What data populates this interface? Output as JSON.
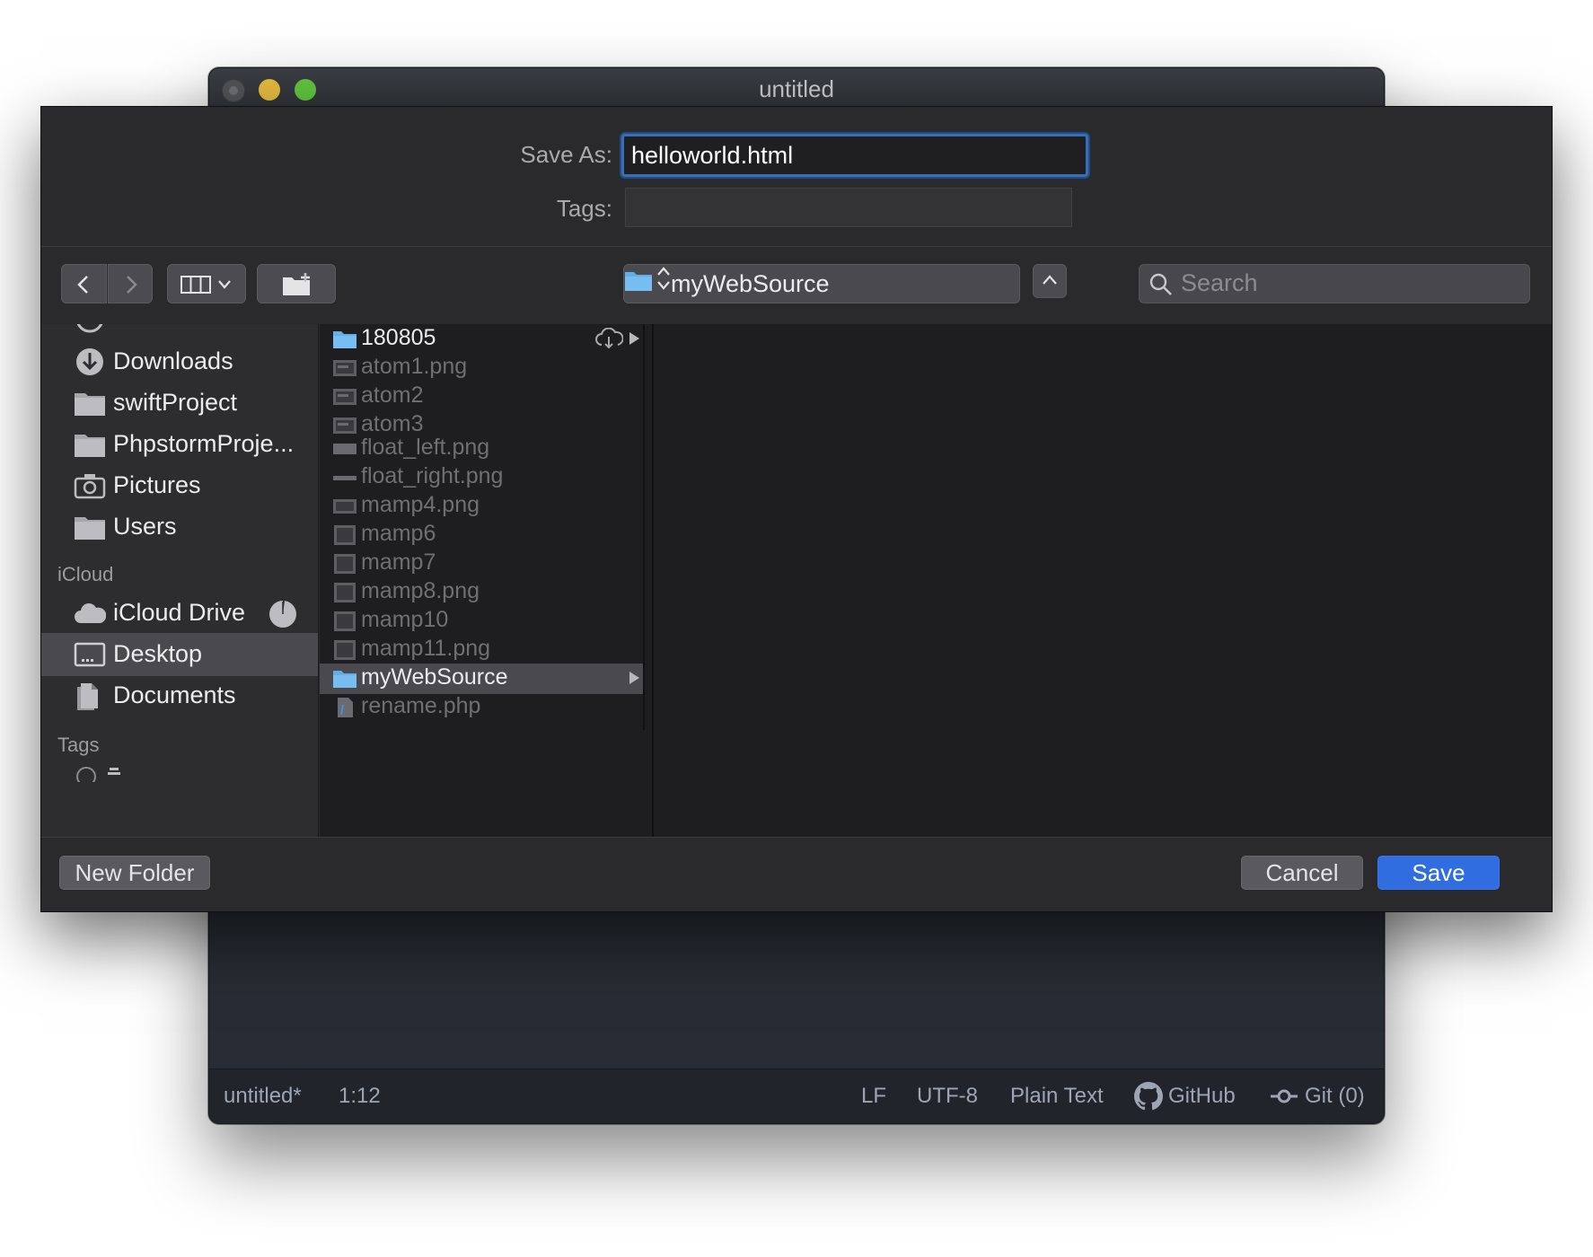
{
  "editor": {
    "title": "untitled",
    "status": {
      "filename": "untitled*",
      "cursor": "1:12",
      "line_ending": "LF",
      "encoding": "UTF-8",
      "grammar": "Plain Text",
      "github": "GitHub",
      "git": "Git (0)"
    }
  },
  "dialog": {
    "save_as_label": "Save As:",
    "save_as_value": "helloworld.html",
    "tags_label": "Tags:",
    "location": "myWebSource",
    "search_placeholder": "Search",
    "sidebar": {
      "favorites": [
        {
          "label": "Downloads",
          "icon": "downloads-icon"
        },
        {
          "label": "swiftProject",
          "icon": "folder-icon"
        },
        {
          "label": "PhpstormProje...",
          "icon": "folder-icon"
        },
        {
          "label": "Pictures",
          "icon": "camera-icon"
        },
        {
          "label": "Users",
          "icon": "folder-icon"
        }
      ],
      "icloud_header": "iCloud",
      "icloud": [
        {
          "label": "iCloud Drive",
          "icon": "cloud-icon"
        },
        {
          "label": "Desktop",
          "icon": "desktop-icon",
          "selected": true
        },
        {
          "label": "Documents",
          "icon": "documents-icon"
        }
      ],
      "tags_header": "Tags"
    },
    "files": [
      {
        "name": "180805",
        "type": "folder",
        "enabled": true,
        "cloud": true
      },
      {
        "name": "atom1.png",
        "type": "image",
        "enabled": false
      },
      {
        "name": "atom2",
        "type": "image",
        "enabled": false
      },
      {
        "name": "atom3",
        "type": "image",
        "enabled": false
      },
      {
        "name": "float_left.png",
        "type": "image",
        "enabled": false
      },
      {
        "name": "float_right.png",
        "type": "image",
        "enabled": false
      },
      {
        "name": "mamp4.png",
        "type": "image",
        "enabled": false
      },
      {
        "name": "mamp6",
        "type": "image",
        "enabled": false
      },
      {
        "name": "mamp7",
        "type": "image",
        "enabled": false
      },
      {
        "name": "mamp8.png",
        "type": "image",
        "enabled": false
      },
      {
        "name": "mamp10",
        "type": "image",
        "enabled": false
      },
      {
        "name": "mamp11.png",
        "type": "image",
        "enabled": false
      },
      {
        "name": "myWebSource",
        "type": "folder",
        "enabled": true,
        "selected": true
      },
      {
        "name": "rename.php",
        "type": "php",
        "enabled": false
      }
    ],
    "buttons": {
      "new_folder": "New Folder",
      "cancel": "Cancel",
      "save": "Save"
    },
    "colors": {
      "accent": "#2f6de1",
      "folder": "#62aee6"
    }
  }
}
